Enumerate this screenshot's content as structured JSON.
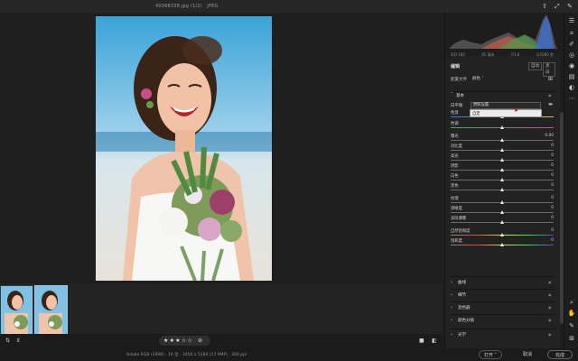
{
  "window": {
    "title": "40088338.jpg (1/2) · JPEG"
  },
  "toolbar_icons": {
    "share": "share-icon",
    "expand": "expand-icon",
    "pen": "pen-icon"
  },
  "camera_info": {
    "iso": "ISO 100",
    "focal": "85 毫米",
    "aperture": "f/1.8",
    "shutter": "1/2000 秒"
  },
  "edit_panel": {
    "title": "编辑",
    "auto_label": "自动",
    "bw_label": "黑白",
    "profile_label": "配置文件",
    "profile_value": "颜色",
    "basic_label": "基本",
    "wb_label": "白平衡",
    "wb_value": "原照设置",
    "dropdown_option": "自定"
  },
  "sliders": [
    {
      "label": "色温",
      "value": "",
      "pos": 0.5
    },
    {
      "label": "色调",
      "value": "",
      "pos": 0.5
    },
    {
      "label": "曝光",
      "value": "0.00",
      "pos": 0.5
    },
    {
      "label": "对比度",
      "value": "0",
      "pos": 0.5
    },
    {
      "label": "高光",
      "value": "0",
      "pos": 0.5
    },
    {
      "label": "阴影",
      "value": "0",
      "pos": 0.5
    },
    {
      "label": "白色",
      "value": "0",
      "pos": 0.5
    },
    {
      "label": "黑色",
      "value": "0",
      "pos": 0.5
    },
    {
      "label": "纹理",
      "value": "0",
      "pos": 0.5
    },
    {
      "label": "清晰度",
      "value": "0",
      "pos": 0.5
    },
    {
      "label": "去除薄雾",
      "value": "0",
      "pos": 0.5
    },
    {
      "label": "自然饱和度",
      "value": "0",
      "pos": 0.5
    },
    {
      "label": "饱和度",
      "value": "0",
      "pos": 0.5
    }
  ],
  "sections": [
    "曲线",
    "细节",
    "混色器",
    "颜色分级",
    "光学"
  ],
  "rating": {
    "stars": "★★★☆☆",
    "count": 3
  },
  "status": {
    "info": "Adobe RGB (1998) · 16 位 · 3456 x 5184 (17.9MP) · 300 ppi",
    "open_label": "打开",
    "cancel_label": "取消",
    "done_label": "完成"
  },
  "colors": {
    "accent": "#a9c2e8",
    "panel": "#222222",
    "background": "#1e1e1e"
  }
}
